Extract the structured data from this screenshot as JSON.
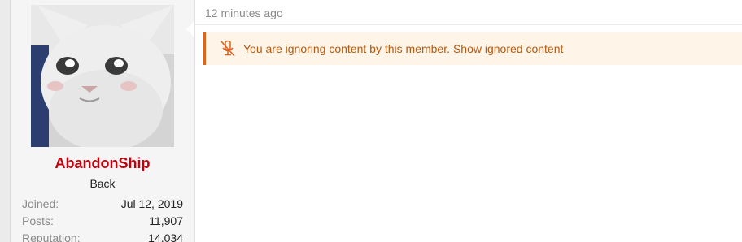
{
  "post": {
    "timestamp": "12 minutes ago"
  },
  "user": {
    "name": "AbandonShip",
    "title": "Back",
    "stats": [
      {
        "label": "Joined:",
        "value": "Jul 12, 2019"
      },
      {
        "label": "Posts:",
        "value": "11,907"
      },
      {
        "label": "Reputation:",
        "value": "14,034"
      }
    ]
  },
  "notice": {
    "icon": "mute-microphone-icon",
    "text": "You are ignoring content by this member.",
    "link_label": "Show ignored content"
  },
  "colors": {
    "username": "#c3000c",
    "notice_background": "#fef4e8",
    "notice_border": "#e2611b",
    "notice_text": "#b55a10"
  }
}
